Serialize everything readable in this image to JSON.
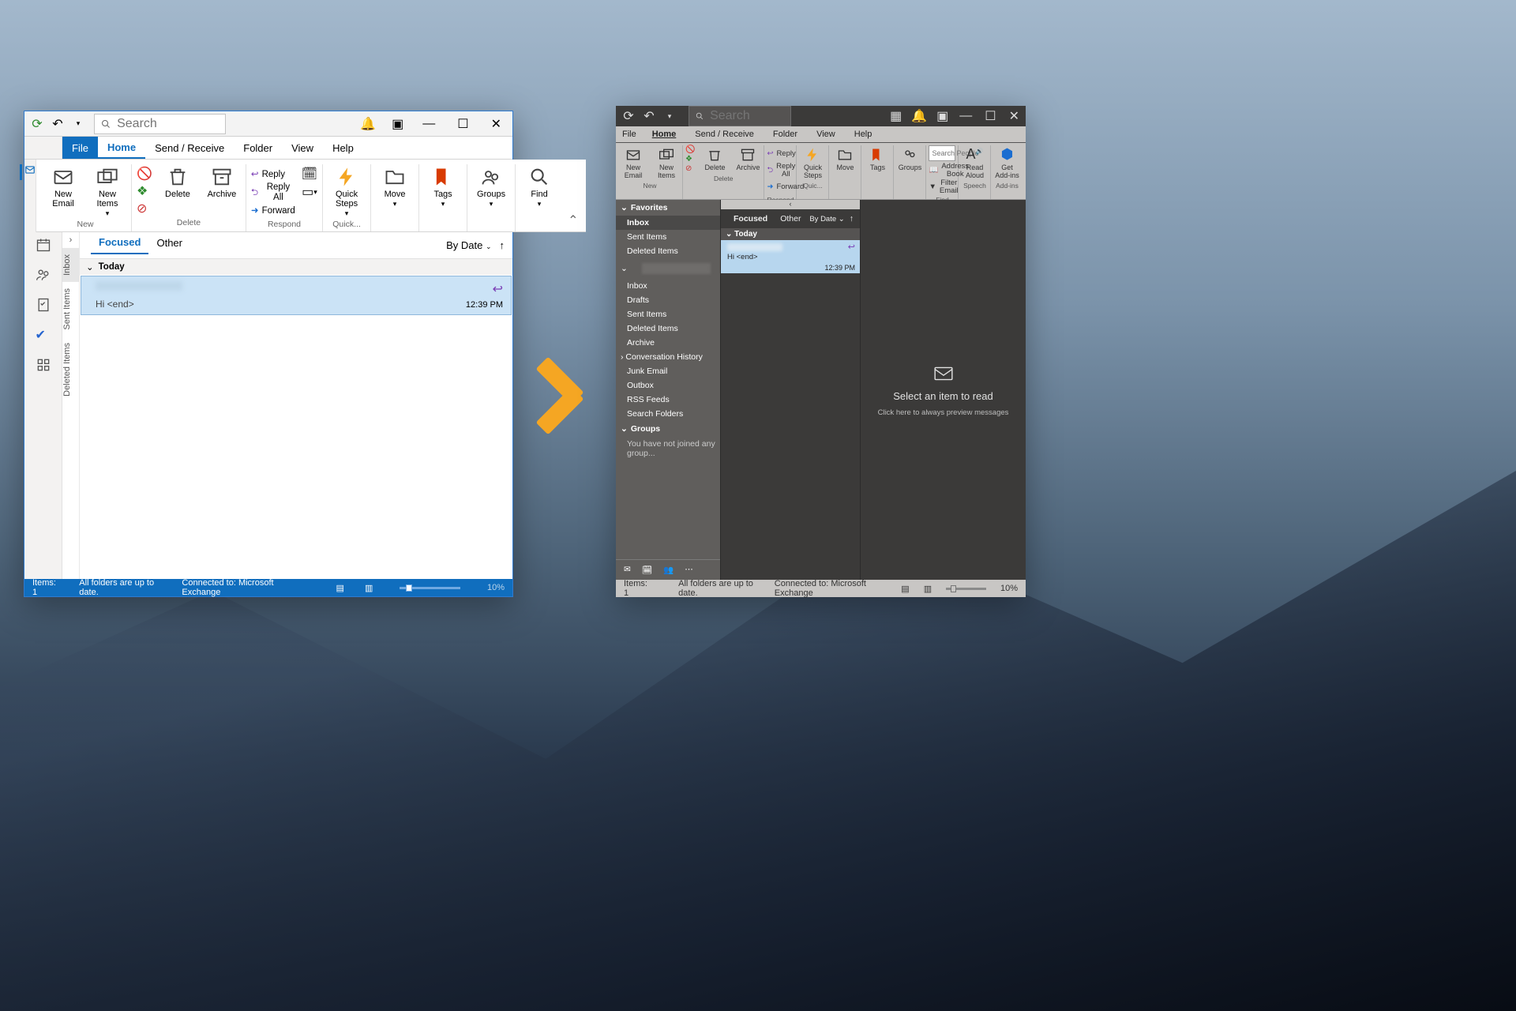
{
  "menu": {
    "file": "File",
    "home": "Home",
    "sendrecv": "Send / Receive",
    "folder": "Folder",
    "view": "View",
    "help": "Help"
  },
  "ribbon": {
    "new_email": "New\nEmail",
    "new_items": "New\nItems",
    "new_grp": "New",
    "delete": "Delete",
    "archive": "Archive",
    "delete_grp": "Delete",
    "reply": "Reply",
    "reply_all": "Reply All",
    "forward": "Forward",
    "respond_grp": "Respond",
    "quick_steps": "Quick\nSteps",
    "quick_grp": "Quick...",
    "quick_grp2": "Quic...",
    "move": "Move",
    "tags": "Tags",
    "groups": "Groups",
    "find": "Find",
    "search_people_ph": "Search People",
    "address_book": "Address Book",
    "filter_email": "Filter Email",
    "find_grp": "Find",
    "read_aloud": "Read\nAloud",
    "speech_grp": "Speech",
    "get_addins": "Get\nAdd-ins",
    "addins_grp": "Add-ins"
  },
  "search_placeholder": "Search",
  "light": {
    "vfolders": [
      "Inbox",
      "Sent Items",
      "Deleted Items"
    ],
    "focused": "Focused",
    "other": "Other",
    "bydate": "By Date",
    "today": "Today",
    "msg_preview": "Hi <end>",
    "msg_time": "12:39 PM"
  },
  "dark": {
    "favorites": "Favorites",
    "fav_items": [
      "Inbox",
      "Sent Items",
      "Deleted Items"
    ],
    "folders": [
      "Inbox",
      "Drafts",
      "Sent Items",
      "Deleted Items",
      "Archive",
      "Conversation History",
      "Junk Email",
      "Outbox",
      "RSS Feeds",
      "Search Folders"
    ],
    "groups": "Groups",
    "groups_empty": "You have not joined any group...",
    "focused": "Focused",
    "other": "Other",
    "bydate": "By Date",
    "today": "Today",
    "msg_preview": "Hi <end>",
    "msg_time": "12:39 PM",
    "reading_title": "Select an item to read",
    "reading_sub": "Click here to always preview messages"
  },
  "status": {
    "items": "Items: 1",
    "uptodate": "All folders are up to date.",
    "connected": "Connected to: Microsoft Exchange",
    "zoom": "10%"
  }
}
